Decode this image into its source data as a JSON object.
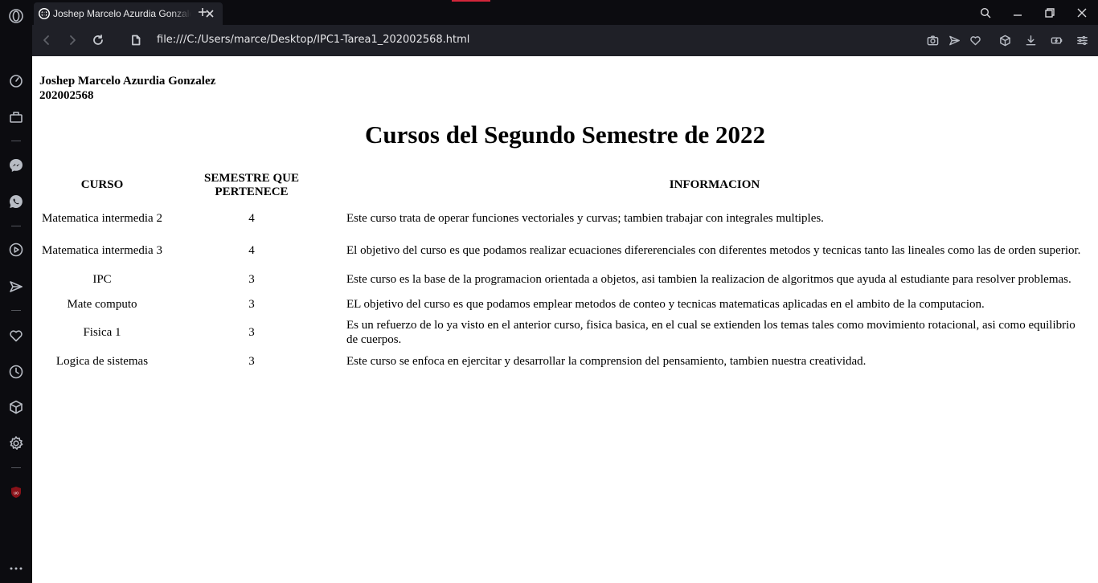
{
  "browser": {
    "tab": {
      "title": "Joshep Marcelo Azurdia Gonzalez"
    },
    "address": {
      "url": "file:///C:/Users/marce/Desktop/IPC1-Tarea1_202002568.html"
    },
    "accent_color": "#d3263a",
    "sidebar_icons": [
      "opera-logo-icon",
      "speed-dial-icon",
      "workspaces-icon",
      "messenger-icon",
      "whatsapp-icon",
      "player-icon",
      "flow-icon",
      "bookmarks-icon",
      "history-icon",
      "extensions-icon",
      "settings-icon",
      "ublock-icon",
      "more-icon"
    ]
  },
  "page": {
    "author": {
      "name": "Joshep Marcelo Azurdia Gonzalez",
      "id": "202002568"
    },
    "heading": "Cursos del Segundo Semestre de 2022",
    "table": {
      "headers": {
        "course": "CURSO",
        "semester": "SEMESTRE QUE PERTENECE",
        "info": "INFORMACION"
      },
      "rows": [
        {
          "course": "Matematica intermedia 2",
          "semester": "4",
          "info": "Este curso trata de operar funciones vectoriales y curvas; tambien trabajar con integrales multiples."
        },
        {
          "course": "Matematica intermedia 3",
          "semester": "4",
          "info": "El objetivo del curso es que podamos realizar ecuaciones difererenciales con diferentes metodos y tecnicas tanto las lineales como las de orden superior."
        },
        {
          "course": "IPC",
          "semester": "3",
          "info": "Este curso es la base de la programacion orientada a objetos, asi tambien la realizacion de algoritmos que ayuda al estudiante para resolver problemas."
        },
        {
          "course": "Mate computo",
          "semester": "3",
          "info": "EL objetivo del curso es que podamos emplear metodos de conteo y tecnicas matematicas aplicadas en el ambito de la computacion."
        },
        {
          "course": "Fisica 1",
          "semester": "3",
          "info": "Es un refuerzo de lo ya visto en el anterior curso, fisica basica, en el cual se extienden los temas tales como movimiento rotacional, asi como equilibrio de cuerpos."
        },
        {
          "course": "Logica de sistemas",
          "semester": "3",
          "info": "Este curso se enfoca en ejercitar y desarrollar la comprension del pensamiento, tambien nuestra creatividad."
        }
      ]
    }
  }
}
